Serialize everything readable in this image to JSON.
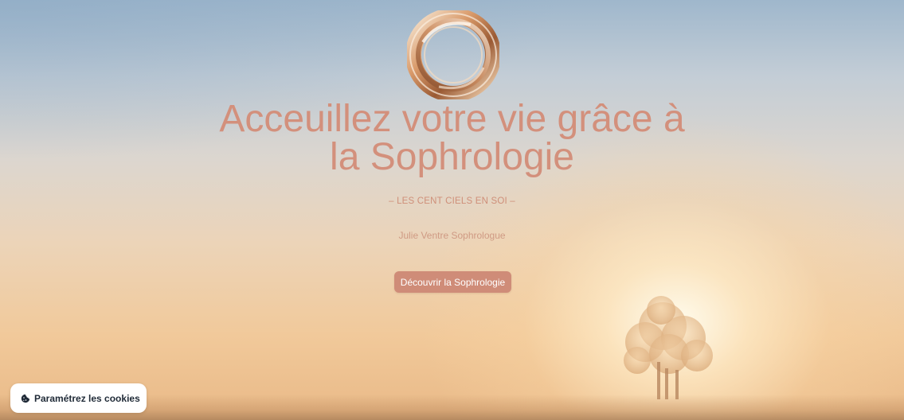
{
  "hero": {
    "title_line1": "Acceuillez votre vie grâce à",
    "title_line2": "la Sophrologie",
    "subtitle": "– LES CENT CIELS EN SOI –",
    "author": "Julie Ventre Sophrologue",
    "cta_label": "Découvrir la Sophrologie"
  },
  "cookie_button": {
    "label": "Paramétrez les cookies",
    "icon": "cookie-icon"
  },
  "colors": {
    "title": "#d3907c",
    "cta_background": "#cf8c78",
    "cookie_text": "#1f2a37"
  },
  "icons": {
    "logo": "swirl-ring-logo",
    "tree": "tree-silhouette"
  }
}
